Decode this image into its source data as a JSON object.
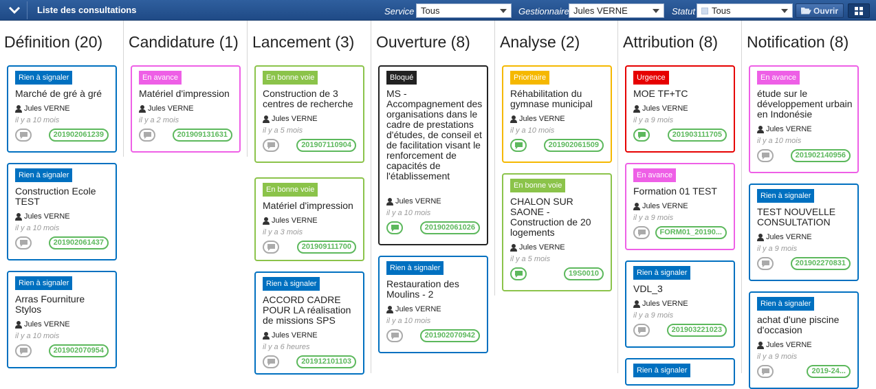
{
  "header": {
    "title": "Liste des consultations",
    "filters": [
      {
        "label": "Service",
        "value": "Tous"
      },
      {
        "label": "Gestionnaire",
        "value": "Jules VERNE"
      },
      {
        "label": "Statut",
        "value": "Tous"
      }
    ],
    "open_label": "Ouvrir"
  },
  "columns": [
    {
      "title": "Définition (20)",
      "cards": [
        {
          "badge": "Rien à signaler",
          "title": "Marché de gré à gré",
          "user": "Jules VERNE",
          "time": "il y a 10 mois",
          "ref": "201902061239"
        },
        {
          "badge": "Rien à signaler",
          "title": "Construction Ecole TEST",
          "user": "Jules VERNE",
          "time": "il y a 10 mois",
          "ref": "201902061437"
        },
        {
          "badge": "Rien à signaler",
          "title": "Arras Fourniture Stylos",
          "user": "Jules VERNE",
          "time": "il y a 10 mois",
          "ref": "201902070954"
        }
      ]
    },
    {
      "title": "Candidature (1)",
      "cards": [
        {
          "badge": "En avance",
          "title": "Matériel d'impression",
          "user": "Jules VERNE",
          "time": "il y a 2 mois",
          "ref": "201909131631"
        }
      ]
    },
    {
      "title": "Lancement (3)",
      "cards": [
        {
          "badge": "En bonne voie",
          "title": "Construction de 3 centres de recherche",
          "user": "Jules VERNE",
          "time": "il y a 5 mois",
          "ref": "201907110904"
        },
        {
          "badge": "En bonne voie",
          "title": "Matériel d'impression",
          "user": "Jules VERNE",
          "time": "il y a 3 mois",
          "ref": "201909111700"
        },
        {
          "badge": "Rien à signaler",
          "title": "ACCORD CADRE POUR LA réalisation de missions SPS",
          "user": "Jules VERNE",
          "time": "il y a 6 heures",
          "ref": "201912101103"
        }
      ]
    },
    {
      "title": "Ouverture (8)",
      "cards": [
        {
          "badge": "Bloqué",
          "title": "MS - Accompagnement des organisations dans le cadre de prestations d'études, de conseil et de facilitation visant le renforcement de capacités de l'établissement",
          "user": "Jules VERNE",
          "time": "il y a 10 mois",
          "ref": "201902061026"
        },
        {
          "badge": "Rien à signaler",
          "title": "Restauration des Moulins - 2",
          "user": "Jules VERNE",
          "time": "il y a 10 mois",
          "ref": "201902070942"
        }
      ]
    },
    {
      "title": "Analyse (2)",
      "cards": [
        {
          "badge": "Prioritaire",
          "title": "Réhabilitation du gymnase municipal",
          "user": "Jules VERNE",
          "time": "il y a 10 mois",
          "ref": "201902061509"
        },
        {
          "badge": "En bonne voie",
          "title": "CHALON SUR SAONE - Construction de 20 logements",
          "user": "Jules VERNE",
          "time": "il y a 5 mois",
          "ref": "19S0010"
        }
      ]
    },
    {
      "title": "Attribution (8)",
      "cards": [
        {
          "badge": "Urgence",
          "title": "MOE TF+TC",
          "user": "Jules VERNE",
          "time": "il y a 9 mois",
          "ref": "201903111705"
        },
        {
          "badge": "En avance",
          "title": "Formation 01 TEST",
          "user": "Jules VERNE",
          "time": "il y a 9 mois",
          "ref": "FORM01_20190..."
        },
        {
          "badge": "Rien à signaler",
          "title": "VDL_3",
          "user": "Jules VERNE",
          "time": "il y a 9 mois",
          "ref": "201903221023"
        },
        {
          "badge": "Rien à signaler",
          "title": "",
          "user": "",
          "time": "",
          "ref": ""
        }
      ]
    },
    {
      "title": "Notification (8)",
      "cards": [
        {
          "badge": "En avance",
          "title": "étude sur le développement urbain en Indonésie",
          "user": "Jules VERNE",
          "time": "il y a 10 mois",
          "ref": "201902140956"
        },
        {
          "badge": "Rien à signaler",
          "title": "TEST NOUVELLE CONSULTATION",
          "user": "Jules VERNE",
          "time": "il y a 9 mois",
          "ref": "201902270831"
        },
        {
          "badge": "Rien à signaler",
          "title": "achat d'une piscine d'occasion",
          "user": "Jules VERNE",
          "time": "il y a 9 mois",
          "ref": "2019-24..."
        }
      ]
    }
  ],
  "status_colors": {
    "Rien à signaler": "#0070c0",
    "En avance": "#ee5fe6",
    "En bonne voie": "#8bc34a",
    "Bloqué": "#222222",
    "Prioritaire": "#f5b800",
    "Urgence": "#e60000"
  }
}
